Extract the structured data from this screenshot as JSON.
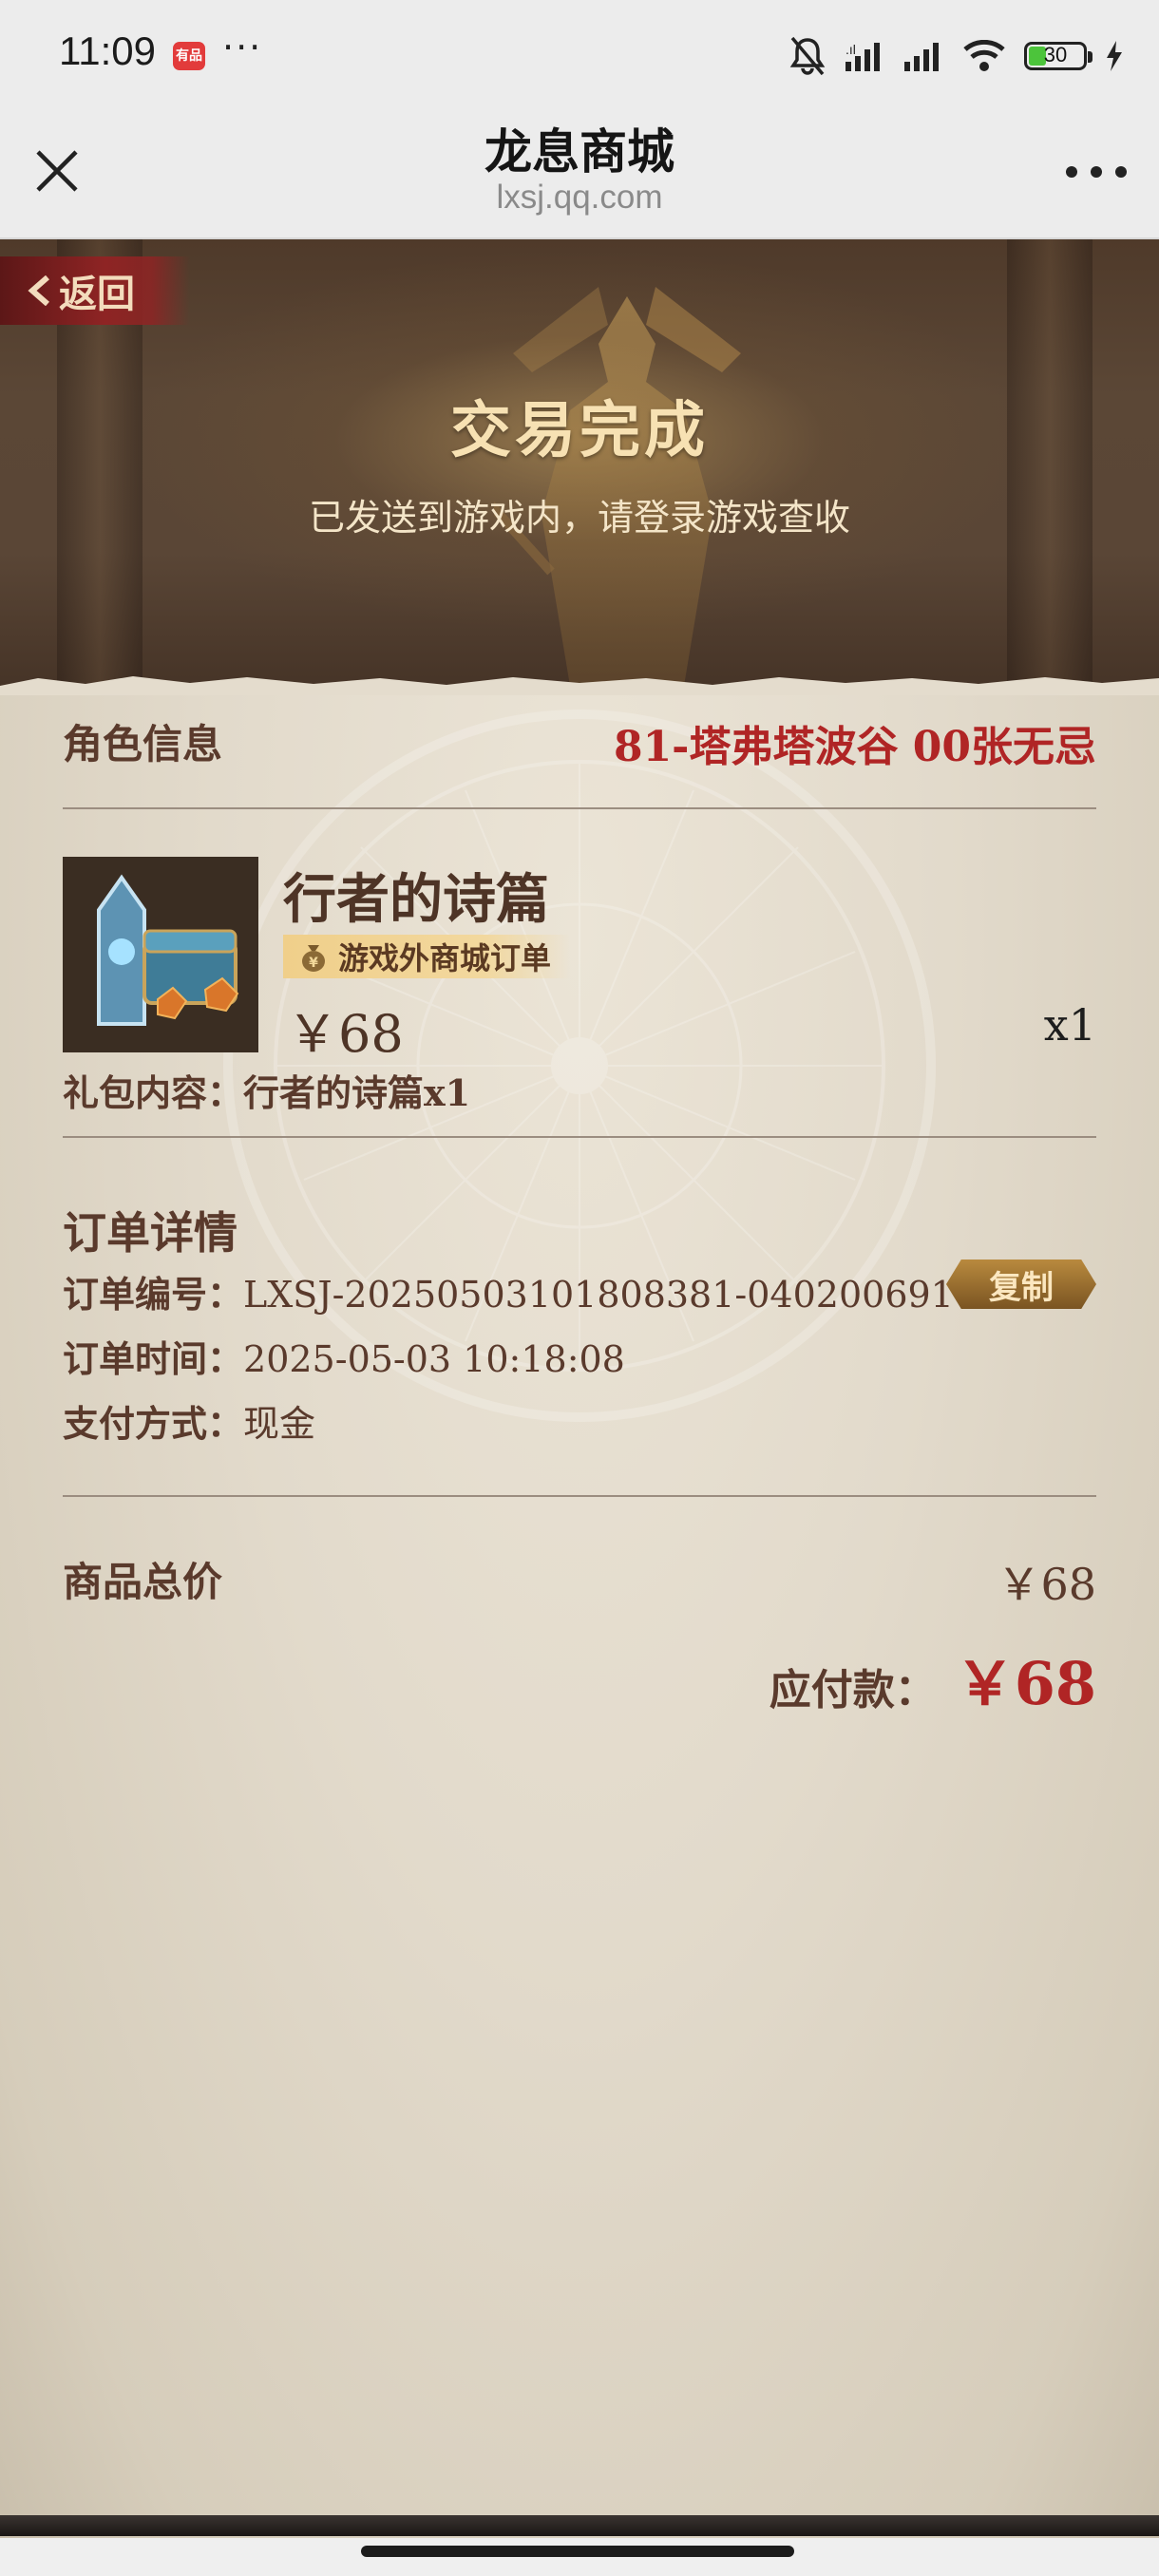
{
  "status_bar": {
    "time": "11:09",
    "app_icon_label": "有品",
    "more": "···",
    "battery": "30"
  },
  "title_bar": {
    "title": "龙息商城",
    "subtitle": "lxsj.qq.com"
  },
  "hero": {
    "back_label": "返回",
    "title": "交易完成",
    "subtitle": "已发送到游戏内，请登录游戏查收"
  },
  "role": {
    "label": "角色信息",
    "value": "81-塔弗塔波谷 00张无忌"
  },
  "product": {
    "name": "行者的诗篇",
    "badge": "游戏外商城订单",
    "price": "￥68",
    "quantity": "x1",
    "contents": "礼包内容：行者的诗篇x1"
  },
  "order": {
    "section_title": "订单详情",
    "number_label": "订单编号：",
    "number": "LXSJ-20250503101808381-040200691",
    "copy_label": "复制",
    "time_label": "订单时间：",
    "time": "2025-05-03 10:18:08",
    "payment_label": "支付方式：",
    "payment": "现金"
  },
  "totals": {
    "total_label": "商品总价",
    "total_value": "￥68",
    "payable_label": "应付款：",
    "payable_value": "￥68"
  },
  "colors": {
    "accent_red": "#b02525",
    "text_brown": "#5a3a2c",
    "gold": "#f7e1b3"
  }
}
